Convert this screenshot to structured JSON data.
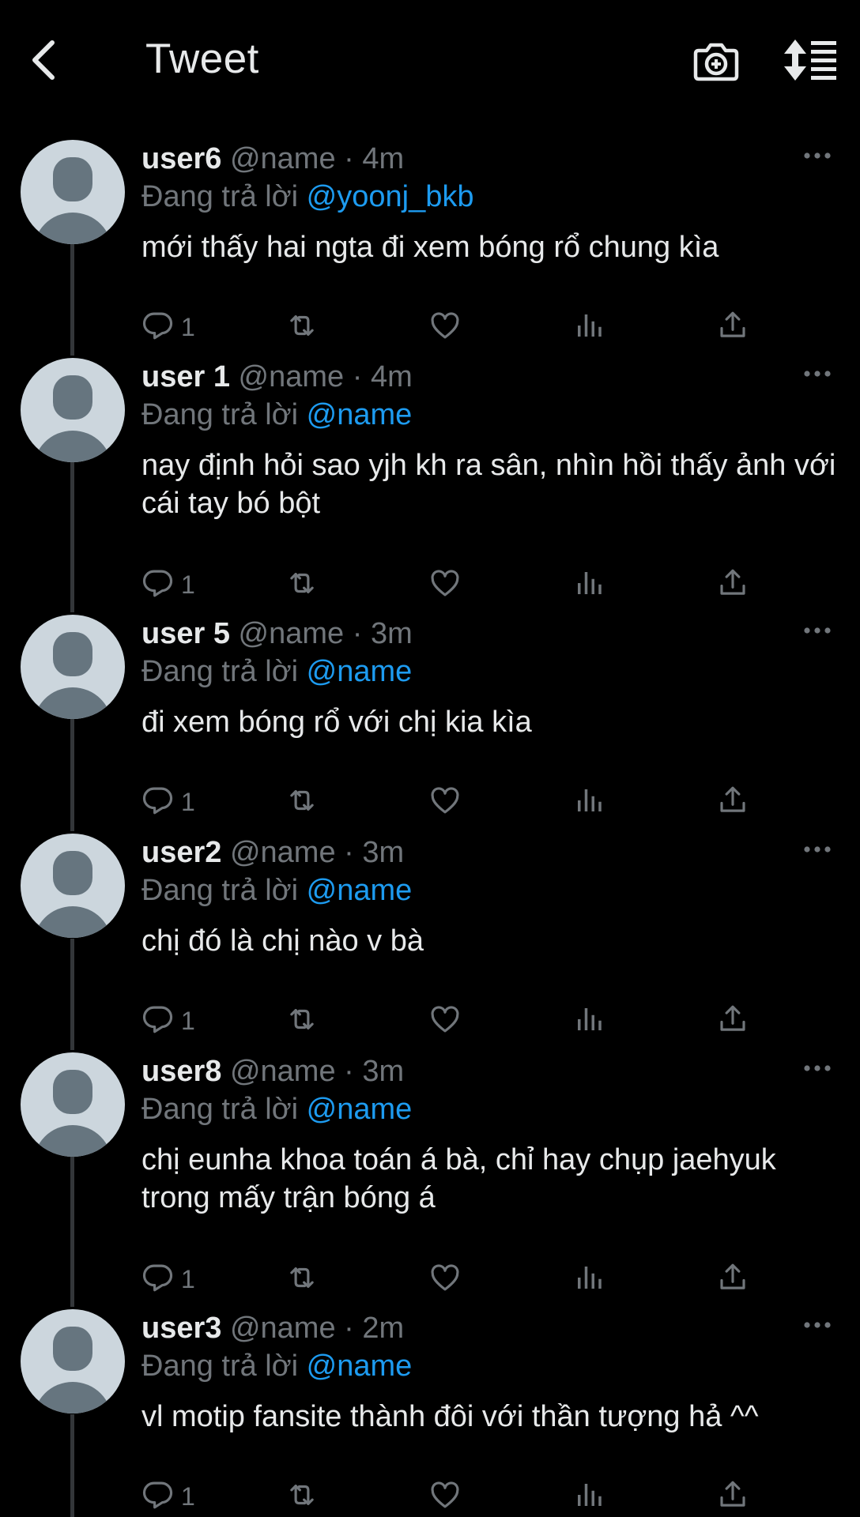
{
  "header": {
    "title": "Tweet"
  },
  "icons": {
    "back": "chevron-left-icon",
    "camera": "camera-add-icon",
    "sort": "sort-icon",
    "more": "more-horizontal-icon",
    "reply": "reply-icon",
    "retweet": "retweet-icon",
    "like": "like-icon",
    "analytics": "analytics-icon",
    "share": "share-icon"
  },
  "colors": {
    "background": "#000000",
    "text": "#e7e9ea",
    "secondary": "#71767b",
    "link": "#1d9bf0",
    "avatar_bg": "#ccd6dd",
    "avatar_fg": "#66757f"
  },
  "replying_label": "Đang trả lời",
  "replies": [
    {
      "username": "user6",
      "handle": "@name",
      "sep": "·",
      "time": "4m",
      "reply_to": "@yoonj_bkb",
      "text": "mới thấy hai ngta đi xem bóng rổ chung kìa",
      "reply_count": "1"
    },
    {
      "username": "user 1",
      "handle": "@name",
      "sep": "·",
      "time": "4m",
      "reply_to": "@name",
      "text": "nay định hỏi sao yjh kh ra sân, nhìn hồi thấy ảnh với cái tay bó bột",
      "reply_count": "1"
    },
    {
      "username": "user 5",
      "handle": "@name",
      "sep": "·",
      "time": "3m",
      "reply_to": "@name",
      "text": "đi xem bóng rổ với chị kia kìa",
      "reply_count": "1"
    },
    {
      "username": "user2",
      "handle": "@name",
      "sep": "·",
      "time": "3m",
      "reply_to": "@name",
      "text": "chị đó là chị nào v bà",
      "reply_count": "1"
    },
    {
      "username": "user8",
      "handle": "@name",
      "sep": "·",
      "time": "3m",
      "reply_to": "@name",
      "text": "chị eunha khoa toán á bà, chỉ hay chụp jaehyuk trong mấy trận bóng á",
      "reply_count": "1"
    },
    {
      "username": "user3",
      "handle": "@name",
      "sep": "·",
      "time": "2m",
      "reply_to": "@name",
      "text": "vl motip fansite thành đôi với thần tượng hả ^^",
      "reply_count": "1"
    }
  ]
}
